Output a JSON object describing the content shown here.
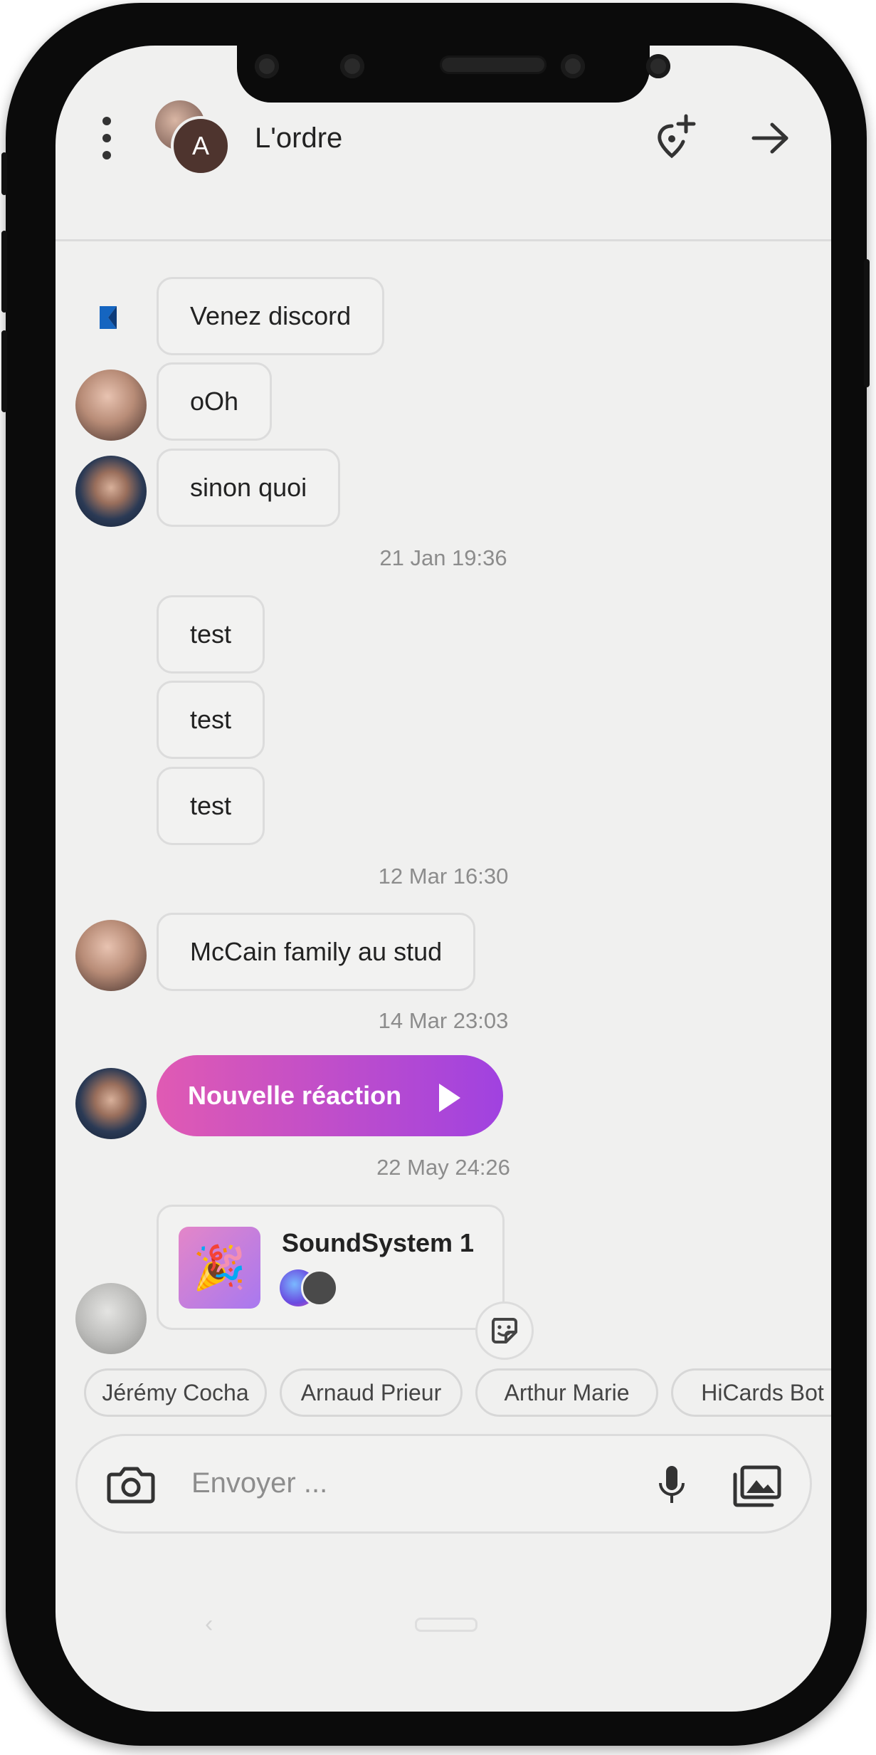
{
  "header": {
    "title": "L'ordre",
    "avatar_initial": "A"
  },
  "messages": {
    "m1": "Venez discord",
    "m2": "oOh",
    "m3": "sinon quoi",
    "ts1": "21 Jan 19:36",
    "m4": "test",
    "m5": "test",
    "m6": "test",
    "ts2": "12 Mar 16:30",
    "m7": "McCain family au stud",
    "ts3": "14 Mar 23:03",
    "reaction": "Nouvelle réaction",
    "ts4": "22 May 24:26",
    "card_title": "SoundSystem 1",
    "card_icon": "🎉"
  },
  "chips": [
    "Jérémy Cocha",
    "Arnaud Prieur",
    "Arthur Marie",
    "HiCards Bot"
  ],
  "input": {
    "placeholder": "Envoyer ..."
  },
  "nav": {
    "back_glyph": "‹"
  },
  "colors": {
    "reaction_gradient_start": "#e05ab3",
    "reaction_gradient_end": "#a042e0",
    "background": "#f0f0ef"
  }
}
